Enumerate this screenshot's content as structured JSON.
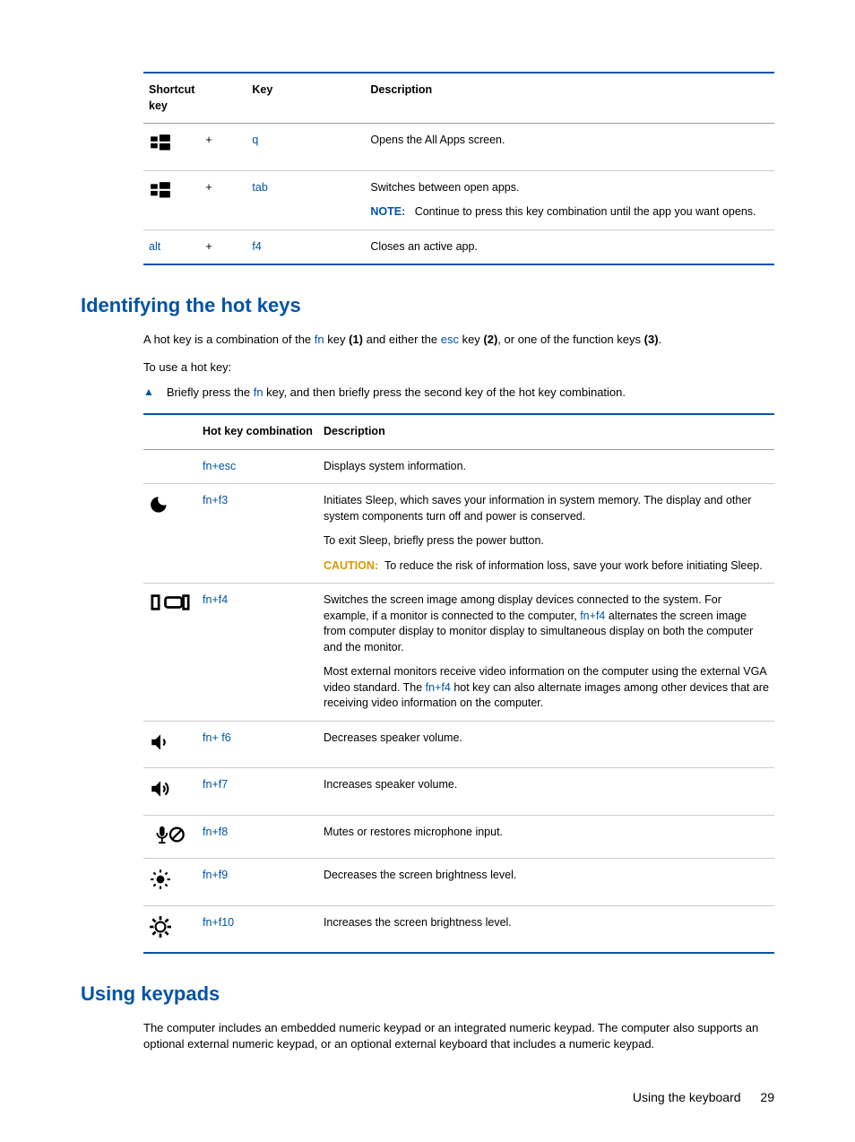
{
  "shortcut_table": {
    "headers": [
      "Shortcut key",
      "",
      "Key",
      "Description"
    ],
    "rows": [
      {
        "icon": "windows",
        "plus": "+",
        "key": "q",
        "desc": "Opens the All Apps screen."
      },
      {
        "icon": "windows",
        "plus": "+",
        "key": "tab",
        "desc": "Switches between open apps.",
        "note_label": "NOTE:",
        "note": "Continue to press this key combination until the app you want opens."
      },
      {
        "alt_text": "alt",
        "plus": "+",
        "key": "f4",
        "desc": "Closes an active app."
      }
    ]
  },
  "heading_hotkeys": "Identifying the hot keys",
  "hotkeys_intro_parts": {
    "p1": "A hot key is a combination of the ",
    "fn": "fn",
    "p2": " key ",
    "b1": "(1)",
    "p3": " and either the ",
    "esc": "esc",
    "p4": " key ",
    "b2": "(2)",
    "p5": ", or one of the function keys ",
    "b3": "(3)",
    "p6": "."
  },
  "hotkeys_use": "To use a hot key:",
  "hotkeys_bullet_parts": {
    "p1": "Briefly press the ",
    "fn": "fn",
    "p2": " key, and then briefly press the second key of the hot key combination."
  },
  "hotkey_table": {
    "headers": [
      "",
      "Hot key combination",
      "Description"
    ],
    "rows": [
      {
        "combo_a": "fn",
        "combo_plus": "+",
        "combo_b": "esc",
        "desc": "Displays system information."
      },
      {
        "icon": "sleep",
        "combo_a": "fn",
        "combo_plus": "+",
        "combo_b": "f3",
        "desc1": "Initiates Sleep, which saves your information in system memory. The display and other system components turn off and power is conserved.",
        "desc2": "To exit Sleep, briefly press the power button.",
        "caution_label": "CAUTION:",
        "caution": "To reduce the risk of information loss, save your work before initiating Sleep."
      },
      {
        "icon": "display",
        "combo_a": "fn",
        "combo_plus": "+",
        "combo_b": "f4",
        "desc1a": "Switches the screen image among display devices connected to the system. For example, if a monitor is connected to the computer, ",
        "desc1_key": "fn+f4",
        "desc1b": " alternates the screen image from computer display to monitor display to simultaneous display on both the computer and the monitor.",
        "desc2a": "Most external monitors receive video information on the computer using the external VGA video standard. The ",
        "desc2_key": "fn+f4",
        "desc2b": " hot key can also alternate images among other devices that are receiving video information on the computer."
      },
      {
        "icon": "vol-down",
        "combo_a": "fn",
        "combo_plus": "+ ",
        "combo_b": "f6",
        "desc": "Decreases speaker volume."
      },
      {
        "icon": "vol-up",
        "combo_a": "fn",
        "combo_plus": "+",
        "combo_b": "f7",
        "desc": "Increases speaker volume."
      },
      {
        "icon": "mic-mute",
        "combo_a": "fn",
        "combo_plus": "+",
        "combo_b": "f8",
        "desc": "Mutes or restores microphone input."
      },
      {
        "icon": "bright-down",
        "combo_a": "fn",
        "combo_plus": "+",
        "combo_b": "f9",
        "desc": "Decreases the screen brightness level."
      },
      {
        "icon": "bright-up",
        "combo_a": "fn",
        "combo_plus": "+",
        "combo_b": "f10",
        "desc": "Increases the screen brightness level."
      }
    ]
  },
  "heading_keypads": "Using keypads",
  "keypads_para": "The computer includes an embedded numeric keypad or an integrated numeric keypad. The computer also supports an optional external numeric keypad, or an optional external keyboard that includes a numeric keypad.",
  "footer_text": "Using the keyboard",
  "footer_page": "29"
}
